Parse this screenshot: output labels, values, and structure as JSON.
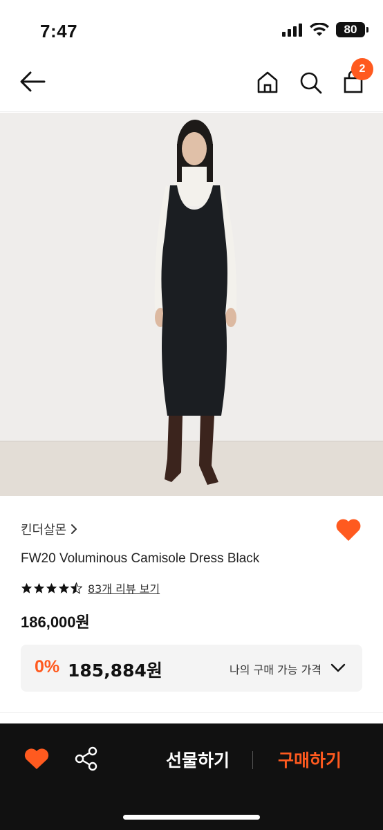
{
  "status_bar": {
    "time": "7:47",
    "battery": "80"
  },
  "header": {
    "cart_count": "2",
    "icons": [
      "back-arrow-icon",
      "home-icon",
      "search-icon",
      "shopping-bag-icon"
    ]
  },
  "product": {
    "brand": "킨더살몬",
    "name": "FW20 Voluminous Camisole Dress Black",
    "rating": 4.5,
    "review_link": "83개 리뷰 보기",
    "price": "186,000원",
    "my_price": {
      "discount": "0%",
      "price": "185,884원",
      "label": "나의 구매 가능 가격"
    }
  },
  "bottom_bar": {
    "gift_label": "선물하기",
    "buy_label": "구매하기"
  },
  "colors": {
    "accent": "#ff5a1f",
    "bottom_bar_bg": "#111111",
    "price_box_bg": "#f4f4f4"
  }
}
